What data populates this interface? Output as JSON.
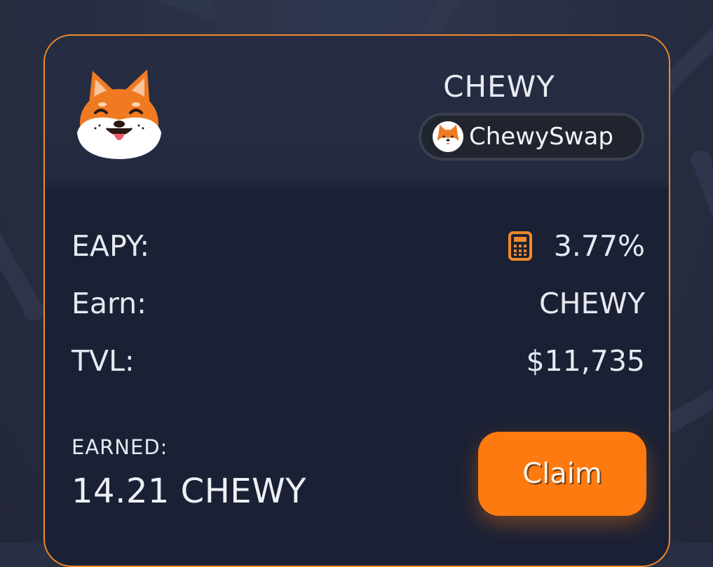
{
  "pool": {
    "token_name": "CHEWY",
    "swap_platform": "ChewySwap",
    "logo_icon": "shiba-inu-dog-icon",
    "swap_icon": "shiba-inu-dog-icon"
  },
  "stats": [
    {
      "label": "EAPY:",
      "value": "3.77%",
      "icon": "calculator-icon"
    },
    {
      "label": "Earn:",
      "value": "CHEWY"
    },
    {
      "label": "TVL:",
      "value": "$11,735"
    }
  ],
  "earned": {
    "label": "EARNED:",
    "value": "14.21 CHEWY"
  },
  "actions": {
    "claim_label": "Claim"
  },
  "colors": {
    "accent": "#f08a2a",
    "button": "#fc7a10",
    "card_bg": "#1b2134",
    "header_bg": "#262d42",
    "text": "#e7e9f0"
  }
}
